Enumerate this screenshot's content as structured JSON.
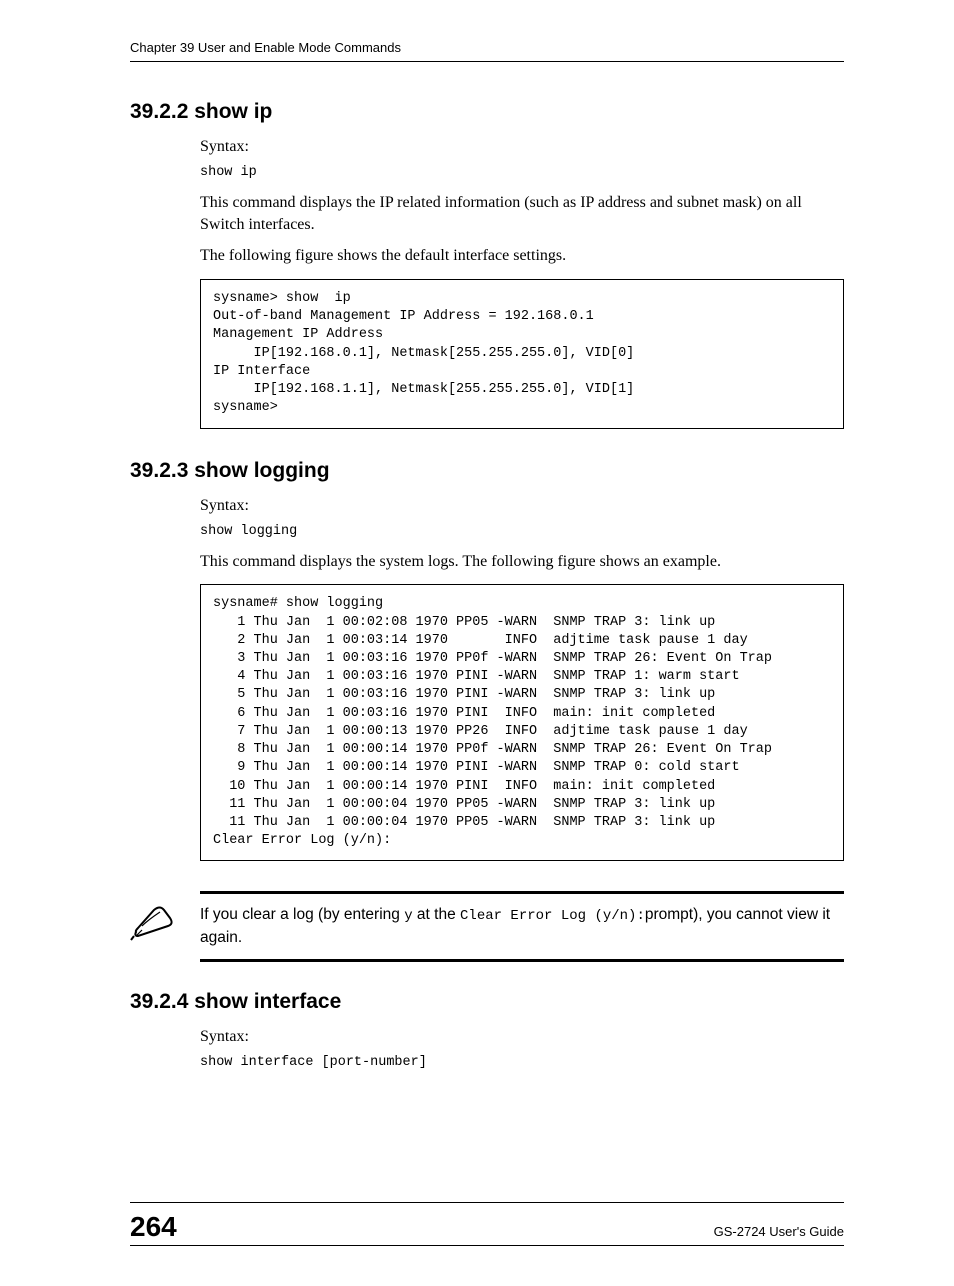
{
  "header": "Chapter 39 User and Enable Mode Commands",
  "sections": {
    "s1": {
      "num_title": "39.2.2  show ip",
      "syntax_label": "Syntax:",
      "syntax_cmd": "show ip",
      "p1": "This command displays the IP related information (such as IP address and subnet mask) on all Switch interfaces.",
      "p2": "The following figure shows the default interface settings.",
      "code": "sysname> show  ip\nOut-of-band Management IP Address = 192.168.0.1\nManagement IP Address\n     IP[192.168.0.1], Netmask[255.255.255.0], VID[0]\nIP Interface\n     IP[192.168.1.1], Netmask[255.255.255.0], VID[1]\nsysname>"
    },
    "s2": {
      "num_title": "39.2.3  show logging",
      "syntax_label": "Syntax:",
      "syntax_cmd": "show logging",
      "p1": "This command displays the system logs. The following figure shows an example.",
      "code": "sysname# show logging\n   1 Thu Jan  1 00:02:08 1970 PP05 -WARN  SNMP TRAP 3: link up\n   2 Thu Jan  1 00:03:14 1970       INFO  adjtime task pause 1 day\n   3 Thu Jan  1 00:03:16 1970 PP0f -WARN  SNMP TRAP 26: Event On Trap\n   4 Thu Jan  1 00:03:16 1970 PINI -WARN  SNMP TRAP 1: warm start\n   5 Thu Jan  1 00:03:16 1970 PINI -WARN  SNMP TRAP 3: link up\n   6 Thu Jan  1 00:03:16 1970 PINI  INFO  main: init completed\n   7 Thu Jan  1 00:00:13 1970 PP26  INFO  adjtime task pause 1 day\n   8 Thu Jan  1 00:00:14 1970 PP0f -WARN  SNMP TRAP 26: Event On Trap\n   9 Thu Jan  1 00:00:14 1970 PINI -WARN  SNMP TRAP 0: cold start\n  10 Thu Jan  1 00:00:14 1970 PINI  INFO  main: init completed\n  11 Thu Jan  1 00:00:04 1970 PP05 -WARN  SNMP TRAP 3: link up\n  11 Thu Jan  1 00:00:04 1970 PP05 -WARN  SNMP TRAP 3: link up\nClear Error Log (y/n):",
      "note_pre": "If you clear a log (by entering ",
      "note_y": "y",
      "note_mid": " at the ",
      "note_prompt": "Clear Error Log (y/n):",
      "note_promptword": "prompt), you cannot view it again."
    },
    "s3": {
      "num_title": "39.2.4  show interface",
      "syntax_label": "Syntax:",
      "syntax_cmd": "show interface [port-number]"
    }
  },
  "footer": {
    "page": "264",
    "guide": "GS-2724 User's Guide"
  }
}
